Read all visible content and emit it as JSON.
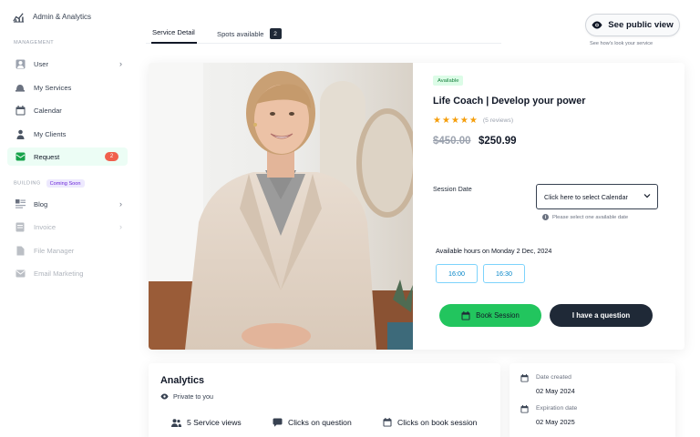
{
  "brand": {
    "name": "Admin & Analytics"
  },
  "sidebar": {
    "management_label": "MANAGEMENT",
    "items": [
      {
        "label": "User",
        "icon": "user-icon"
      },
      {
        "label": "My Services",
        "icon": "bell-icon"
      },
      {
        "label": "Calendar",
        "icon": "calendar-icon"
      },
      {
        "label": "My Clients",
        "icon": "clients-icon"
      },
      {
        "label": "Request",
        "icon": "inbox-icon",
        "badge": "2"
      }
    ],
    "building_label": "BUILDING",
    "coming_soon": "Coming Soon",
    "building_items": [
      {
        "label": "Blog",
        "icon": "blog-icon"
      },
      {
        "label": "Invoice",
        "icon": "invoice-icon"
      },
      {
        "label": "File Manager",
        "icon": "file-icon"
      },
      {
        "label": "Email Marketing",
        "icon": "email-icon"
      }
    ]
  },
  "tabs": {
    "service_detail": "Service Detail",
    "spots_available": "Spots available",
    "spots_count": "2"
  },
  "public_view": {
    "label": "See public view",
    "hint": "See how's look your service"
  },
  "service": {
    "status": "Available",
    "title": "Life Coach | Develop your power",
    "rating": 5,
    "reviews": "(5 reviews)",
    "old_price": "$450.00",
    "price": "$250.99",
    "session_date_label": "Session Date",
    "calendar_placeholder": "Click here to select Calendar",
    "calendar_hint": "Please select one available date",
    "hours_label": "Available hours on Monday 2 Dec, 2024",
    "slots": [
      "16:00",
      "16:30"
    ],
    "book_label": "Book Session",
    "question_label": "I have a question"
  },
  "analytics": {
    "title": "Analytics",
    "privacy": "Private to you",
    "metrics": [
      {
        "label": "5 Service views",
        "icon": "users-icon"
      },
      {
        "label": "Clicks on question",
        "icon": "chat-icon"
      },
      {
        "label": "Clicks on book session",
        "icon": "calendar-icon"
      }
    ]
  },
  "dates": {
    "created_label": "Date created",
    "created_value": "02 May 2024",
    "expiration_label": "Expiration date",
    "expiration_value": "02 May 2025"
  },
  "colors": {
    "accent_green": "#22c55e",
    "badge_red": "#f0604d",
    "dark": "#1f2937",
    "slot_blue": "#0284c7"
  }
}
